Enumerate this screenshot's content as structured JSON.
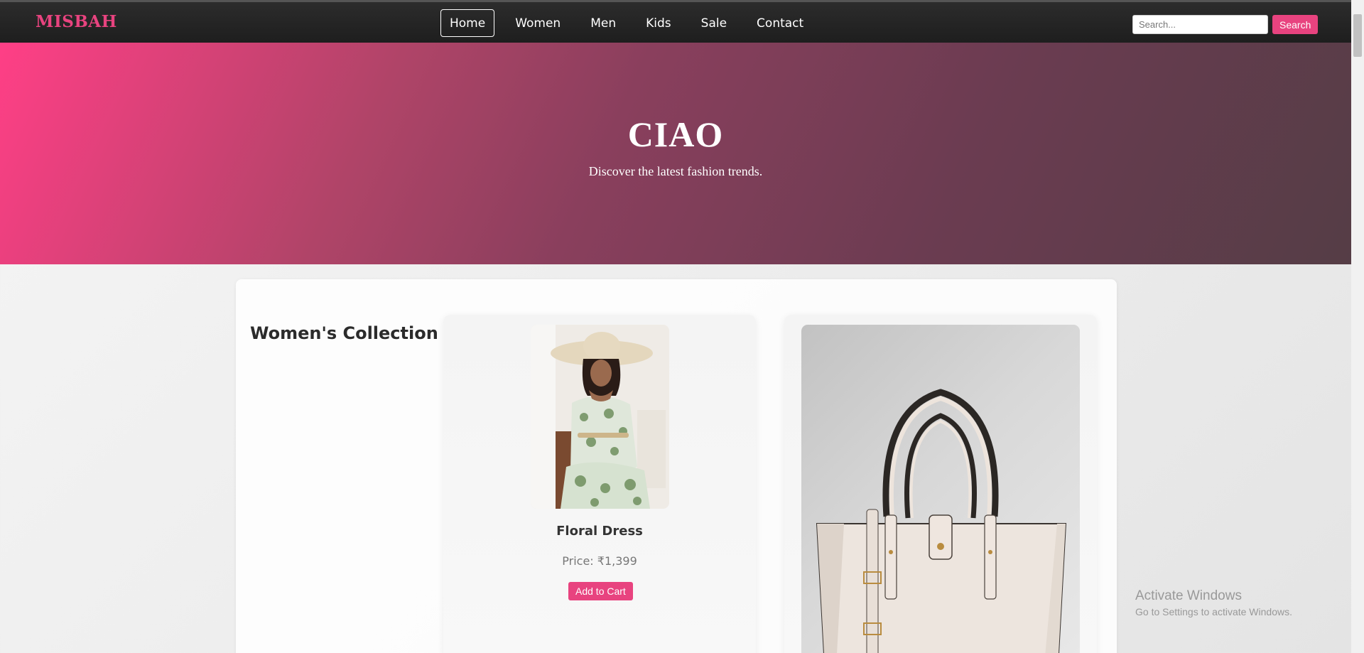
{
  "brand": {
    "name": "MISBAH",
    "color": "#e8437f"
  },
  "nav": {
    "links": [
      {
        "label": "Home",
        "active": true
      },
      {
        "label": "Women",
        "active": false
      },
      {
        "label": "Men",
        "active": false
      },
      {
        "label": "Kids",
        "active": false
      },
      {
        "label": "Sale",
        "active": false
      },
      {
        "label": "Contact",
        "active": false
      }
    ]
  },
  "search": {
    "placeholder": "Search...",
    "value": "",
    "button_label": "Search"
  },
  "hero": {
    "title": "CIAO",
    "subtitle": "Discover the latest fashion trends."
  },
  "collection": {
    "title": "Women's Collection",
    "products": [
      {
        "name": "Floral Dress",
        "price": "Price: ₹1,399",
        "cart_label": "Add to Cart",
        "image": "woman-in-floral-dress-and-sun-hat"
      },
      {
        "image": "cream-leather-handbag"
      }
    ]
  },
  "watermark": {
    "line1": "Activate Windows",
    "line2": "Go to Settings to activate Windows."
  },
  "colors": {
    "accent": "#e8437f",
    "navbar": "#1e1e1e"
  }
}
